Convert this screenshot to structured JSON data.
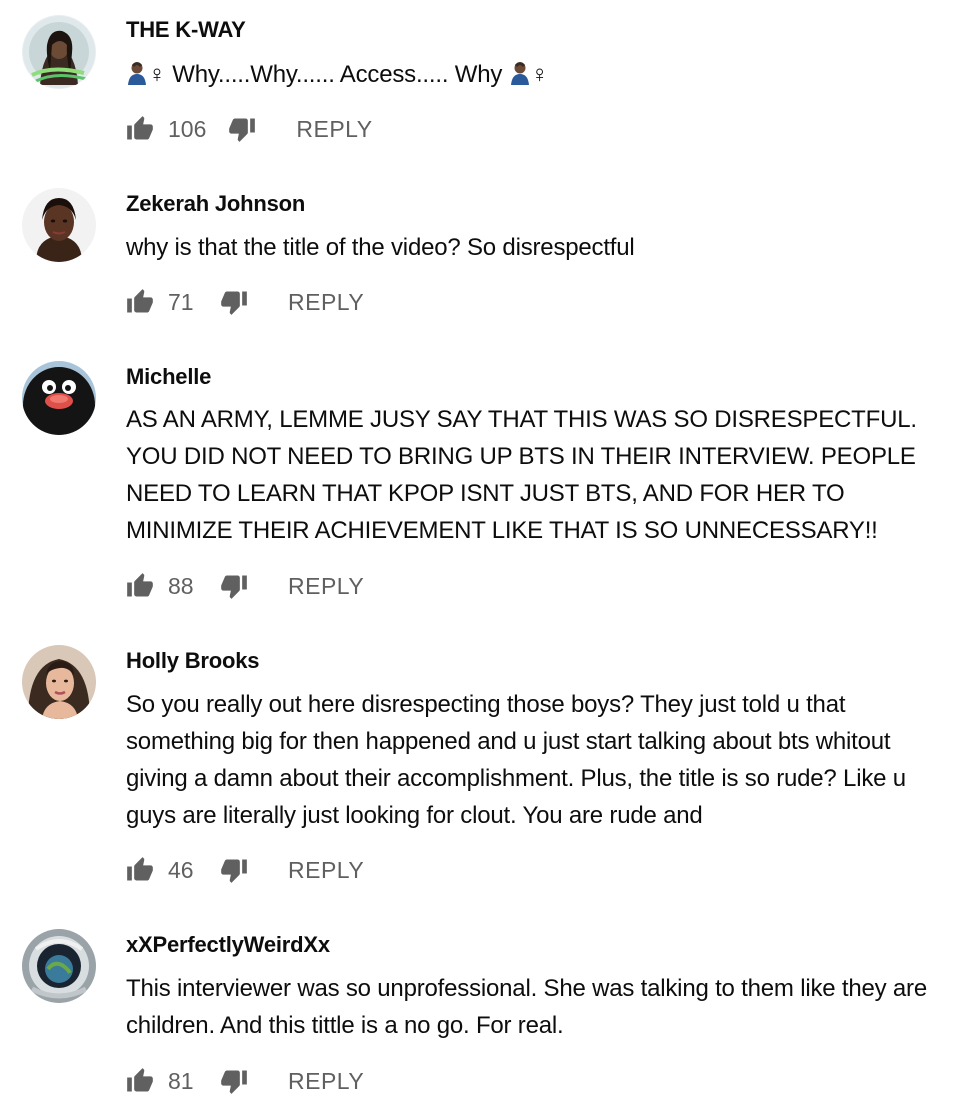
{
  "comments": [
    {
      "author": "THE K-WAY",
      "text_prefix_symbol": "♀",
      "text": "Why.....Why...... Access..... Why",
      "text_suffix_symbol": "♀",
      "likes": "106",
      "reply_label": "REPLY",
      "avatar": "avatar-portrait-dark-hair"
    },
    {
      "author": "Zekerah Johnson",
      "text": "why is that the title of the video? So disrespectful",
      "likes": "71",
      "reply_label": "REPLY",
      "avatar": "avatar-portrait-woman"
    },
    {
      "author": "Michelle",
      "text": "AS AN ARMY, LEMME JUSY SAY THAT THIS WAS SO DISRESPECTFUL. YOU DID NOT NEED TO BRING UP BTS IN THEIR INTERVIEW.  PEOPLE NEED TO LEARN THAT KPOP ISNT JUST BTS, AND FOR HER TO MINIMIZE THEIR ACHIEVEMENT LIKE THAT IS SO UNNECESSARY!!",
      "likes": "88",
      "reply_label": "REPLY",
      "avatar": "avatar-penguin"
    },
    {
      "author": "Holly Brooks",
      "text": "So you really out here disrespecting those boys? They just told u that something big for then happened and u just start talking about bts whitout giving a damn about their accomplishment. Plus, the title is so rude? Like u guys are literally just looking for clout. You are rude and",
      "likes": "46",
      "reply_label": "REPLY",
      "avatar": "avatar-portrait-woman-light"
    },
    {
      "author": "xXPerfectlyWeirdXx",
      "text": "This interviewer was so unprofessional. She was talking to them like they are children. And this tittle is a no go. For real.",
      "likes": "81",
      "reply_label": "REPLY",
      "avatar": "avatar-astronaut-helmet"
    }
  ],
  "colors": {
    "text": "#0d0d0d",
    "meta": "#606060",
    "icon": "#606060"
  },
  "icons": {
    "like": "thumbs-up-icon",
    "dislike": "thumbs-down-icon"
  }
}
